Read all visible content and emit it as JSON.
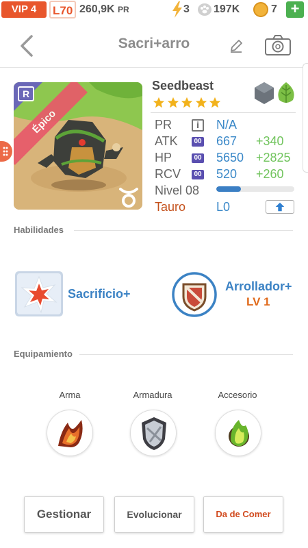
{
  "status": {
    "vip": "VIP 4",
    "level": "L70",
    "pr_amount": "260,9K",
    "pr_unit": "PR",
    "energy": "3",
    "food": "197K",
    "coins": "7",
    "plus_label": "+"
  },
  "header": {
    "title": "Sacri+arro"
  },
  "monster": {
    "rarity": "Épico",
    "r_badge": "R",
    "name": "Seedbeast",
    "stars": 5,
    "elements": [
      "rock-element-icon",
      "leaf-element-icon"
    ],
    "stats": [
      {
        "label": "PR",
        "badge": "i",
        "value": "N/A",
        "bonus": ""
      },
      {
        "label": "ATK",
        "badge": "00",
        "value": "667",
        "bonus": "+340"
      },
      {
        "label": "HP",
        "badge": "00",
        "value": "5650",
        "bonus": "+2825"
      },
      {
        "label": "RCV",
        "badge": "00",
        "value": "520",
        "bonus": "+260"
      }
    ],
    "level_label": "Nivel 08",
    "level_progress": 0.32,
    "sign": "Tauro",
    "sign_level": "L0"
  },
  "abilities": {
    "title": "Habilidades",
    "skill1": {
      "name": "Sacrificio+"
    },
    "skill2": {
      "name": "Arrollador+",
      "level": "LV 1"
    }
  },
  "equipment": {
    "title": "Equipamiento",
    "slots": [
      {
        "label": "Arma"
      },
      {
        "label": "Armadura"
      },
      {
        "label": "Accesorio"
      }
    ]
  },
  "buttons": {
    "manage": "Gestionar",
    "evolve": "Evolucionar",
    "feed": "Da de Comer"
  },
  "colors": {
    "accent": "#e8562c",
    "blue": "#3b82c4",
    "green": "#71c45d",
    "orange": "#e06a1b"
  }
}
